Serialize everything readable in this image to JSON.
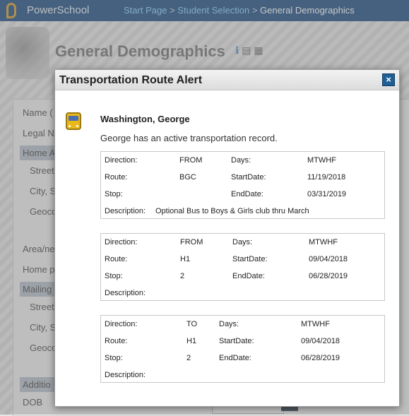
{
  "header": {
    "app_name": "PowerSchool",
    "breadcrumb": [
      {
        "label": "Start Page",
        "link": true
      },
      {
        "label": "Student Selection",
        "link": true
      },
      {
        "label": "General Demographics",
        "link": false
      }
    ],
    "separator": ">"
  },
  "page": {
    "title": "General Demographics",
    "title_icons": [
      "info-icon",
      "document-icon",
      "print-icon"
    ],
    "background_labels": [
      "Name (",
      "Legal N",
      "Home A",
      "Street,",
      "City, S",
      "Geoco",
      "Area/ne",
      "Home p",
      "Mailing",
      "Street,",
      "City, S",
      "Geoco",
      "Additio",
      "DOB"
    ]
  },
  "dialog": {
    "title": "Transportation Route Alert",
    "close_label": "×",
    "student_name": "Washington, George",
    "message": "George has an active transportation record.",
    "labels": {
      "direction": "Direction:",
      "days": "Days:",
      "route": "Route:",
      "start_date": "StartDate:",
      "stop": "Stop:",
      "end_date": "EndDate:",
      "description": "Description:"
    },
    "records": [
      {
        "direction": "FROM",
        "days": "MTWHF",
        "route": "BGC",
        "start_date": "11/19/2018",
        "stop": "",
        "end_date": "03/31/2019",
        "description": "Optional Bus to Boys & Girls club thru March"
      },
      {
        "direction": "FROM",
        "days": "MTWHF",
        "route": "H1",
        "start_date": "09/04/2018",
        "stop": "2",
        "end_date": "06/28/2019",
        "description": ""
      },
      {
        "direction": "TO",
        "days": "MTWHF",
        "route": "H1",
        "start_date": "09/04/2018",
        "stop": "2",
        "end_date": "06/28/2019",
        "description": ""
      }
    ]
  },
  "colors": {
    "header_bg": "#2c5a8a",
    "link": "#8fd0ff",
    "close_button": "#1f5f96",
    "bus_icon": "#e9b81b"
  }
}
